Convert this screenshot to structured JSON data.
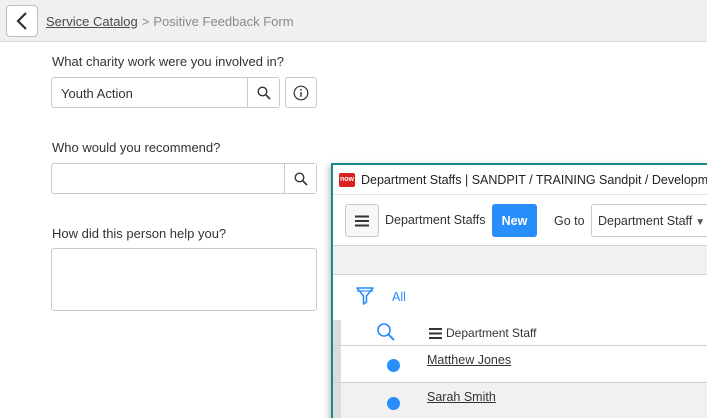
{
  "header": {
    "breadcrumb_link": "Service Catalog",
    "breadcrumb_separator": ">",
    "breadcrumb_current": "Positive Feedback Form"
  },
  "form": {
    "charity_label": "What charity work were you involved in?",
    "charity_value": "Youth Action",
    "recommend_label": "Who would you recommend?",
    "recommend_value": "",
    "help_label": "How did this person help you?",
    "help_value": ""
  },
  "popup": {
    "logo_text": "now",
    "window_title": "Department Staffs | SANDPIT / TRAINING Sandpit / Development",
    "list_title": "Department Staffs",
    "new_label": "New",
    "goto_label": "Go to",
    "goto_selected": "Department Staff",
    "filter_label": "All",
    "column_header": "Department Staff",
    "rows": [
      {
        "name": "Matthew Jones"
      },
      {
        "name": "Sarah Smith"
      }
    ]
  },
  "colors": {
    "accent_blue": "#278efc",
    "window_border": "#1b8a8a",
    "logo_red": "#d9221c"
  }
}
